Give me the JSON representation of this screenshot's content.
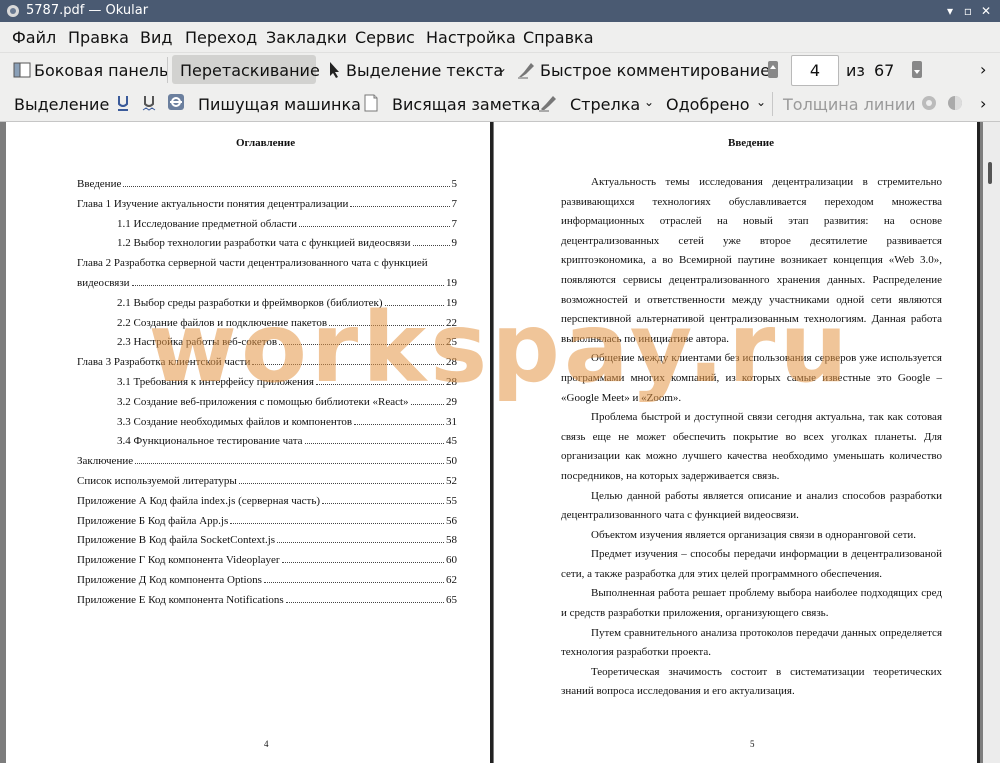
{
  "window": {
    "title": "5787.pdf  — Okular"
  },
  "menu": [
    "Файл",
    "Правка",
    "Вид",
    "Переход",
    "Закладки",
    "Сервис",
    "Настройка",
    "Справка"
  ],
  "toolbar1": {
    "sidebar": "Боковая панель",
    "drag": "Перетаскивание",
    "text_select": "Выделение текста",
    "quick_comment": "Быстрое комментирование",
    "page_current": "4",
    "page_of": "из",
    "page_total": "67"
  },
  "toolbar2": {
    "selection": "Выделение",
    "typewriter": "Пишущая машинка",
    "sticky_note": "Висящая заметка",
    "arrow": "Стрелка",
    "approved": "Одобрено",
    "line_width": "Толщина линии"
  },
  "page4": {
    "title": "Оглавление",
    "toc": [
      {
        "text": "Введение",
        "page": "5",
        "level": 0
      },
      {
        "text": "Глава 1 Изучение актуальности понятия децентрализации",
        "page": "7",
        "level": 0
      },
      {
        "text": "1.1 Исследование предметной области",
        "page": "7",
        "level": 1
      },
      {
        "text": "1.2 Выбор технологии разработки чата с функцией видеосвязи",
        "page": "9",
        "level": 1
      },
      {
        "text": "Глава 2 Разработка серверной части децентрализованного чата с функцией",
        "page": "",
        "level": 0
      },
      {
        "text": "видеосвязи",
        "page": "19",
        "level": 0
      },
      {
        "text": "2.1 Выбор среды разработки и фреймворков (библиотек)",
        "page": "19",
        "level": 1
      },
      {
        "text": "2.2 Создание файлов и подключение пакетов",
        "page": "22",
        "level": 1
      },
      {
        "text": "2.3 Настройка работы веб-сокетов",
        "page": "25",
        "level": 1
      },
      {
        "text": "Глава 3 Разработка клиентской части",
        "page": "28",
        "level": 0
      },
      {
        "text": "3.1 Требования к интерфейсу приложения",
        "page": "28",
        "level": 1
      },
      {
        "text": "3.2 Создание веб-приложения с помощью библиотеки «React»",
        "page": "29",
        "level": 1
      },
      {
        "text": "3.3 Создание необходимых файлов и компонентов",
        "page": "31",
        "level": 1
      },
      {
        "text": "3.4 Функциональное тестирование чата",
        "page": "45",
        "level": 1
      },
      {
        "text": "Заключение",
        "page": "50",
        "level": 0
      },
      {
        "text": "Список используемой литературы",
        "page": "52",
        "level": 0
      },
      {
        "text": "Приложение А Код файла index.js (серверная часть)",
        "page": "55",
        "level": 0
      },
      {
        "text": "Приложение Б Код файла App.js",
        "page": "56",
        "level": 0
      },
      {
        "text": "Приложение В Код файла SocketContext.js",
        "page": "58",
        "level": 0
      },
      {
        "text": "Приложение Г Код компонента Videoplayer",
        "page": "60",
        "level": 0
      },
      {
        "text": "Приложение Д Код компонента Options",
        "page": "62",
        "level": 0
      },
      {
        "text": "Приложение Е Код компонента Notifications",
        "page": "65",
        "level": 0
      }
    ],
    "page_number": "4"
  },
  "page5": {
    "title": "Введение",
    "paragraphs": [
      "Актуальность темы исследования децентрализации в стремительно развивающихся технологиях обуславливается переходом множества информационных отраслей на новый этап развития: на основе децентрализованных сетей уже второе десятилетие развивается криптоэкономика, а во Всемирной паутине возникает концепция «Web 3.0», появляются сервисы децентрализованного хранения данных. Распределение возможностей и ответственности между участниками одной сети являются перспективной альтернативой централизованным технологиям. Данная работа выполнялась по инициативе автора.",
      "Общение между клиентами без использования серверов уже используется программами многих компаний, из которых самые известные это Google – «Google Meet» и «Zoom».",
      "Проблема быстрой и доступной связи сегодня актуальна, так как сотовая связь еще не может обеспечить покрытие во всех уголках планеты. Для организации как можно лучшего качества необходимо уменьшать количество посредников, на которых задерживается связь.",
      "Целью данной работы является описание и анализ способов разработки децентрализованного чата с функцией видеосвязи.",
      "Объектом изучения является организация связи в одноранговой сети.",
      "Предмет изучения – способы передачи информации в децентрализованой сети, а также разработка для этих целей программного обеспечения.",
      "Выполненная работа решает проблему выбора наиболее подходящих сред и средств разработки приложения, организующего связь.",
      "Путем сравнительного анализа протоколов передачи данных определяется технология разработки проекта.",
      "Теоретическая значимость состоит в систематизации теоретических знаний вопроса исследования и его актуализация."
    ],
    "page_number": "5"
  },
  "watermark": "workspay.ru",
  "colors": {
    "titlebar": "#4a5a72",
    "toolbar": "#efefee",
    "viewport": "#7d7d7d",
    "watermark": "#e49646"
  }
}
